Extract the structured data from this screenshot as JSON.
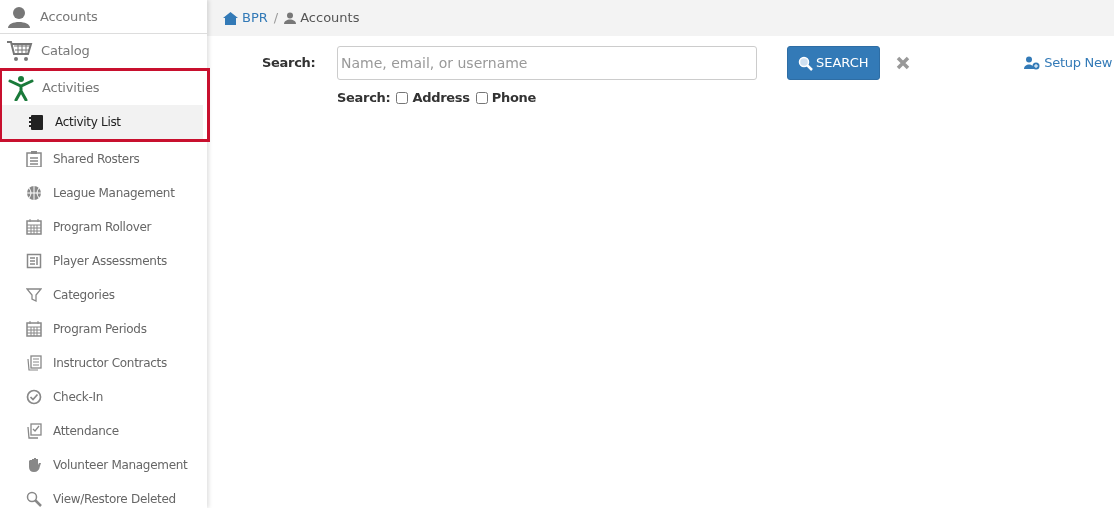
{
  "sidebar": {
    "sections": [
      {
        "label": "Accounts",
        "highlighted": false
      },
      {
        "label": "Catalog",
        "highlighted": false
      },
      {
        "label": "Activities",
        "highlighted": true,
        "children": [
          {
            "label": "Activity List",
            "selected": true
          },
          {
            "label": "Shared Rosters",
            "selected": false
          },
          {
            "label": "League Management",
            "selected": false
          },
          {
            "label": "Program Rollover",
            "selected": false
          },
          {
            "label": "Player Assessments",
            "selected": false
          },
          {
            "label": "Categories",
            "selected": false
          },
          {
            "label": "Program Periods",
            "selected": false
          },
          {
            "label": "Instructor Contracts",
            "selected": false
          },
          {
            "label": "Check-In",
            "selected": false
          },
          {
            "label": "Attendance",
            "selected": false
          },
          {
            "label": "Volunteer Management",
            "selected": false
          },
          {
            "label": "View/Restore Deleted",
            "selected": false
          }
        ]
      }
    ]
  },
  "breadcrumb": [
    "BPR",
    "Accounts"
  ],
  "breadcrumb_separator": "/",
  "search": {
    "label": "Search:",
    "placeholder": "Name, email, or username",
    "button": "SEARCH",
    "setup_link": "Setup New",
    "options_label": "Search:",
    "options": [
      {
        "label": "Address",
        "checked": false
      },
      {
        "label": "Phone",
        "checked": false
      }
    ]
  }
}
